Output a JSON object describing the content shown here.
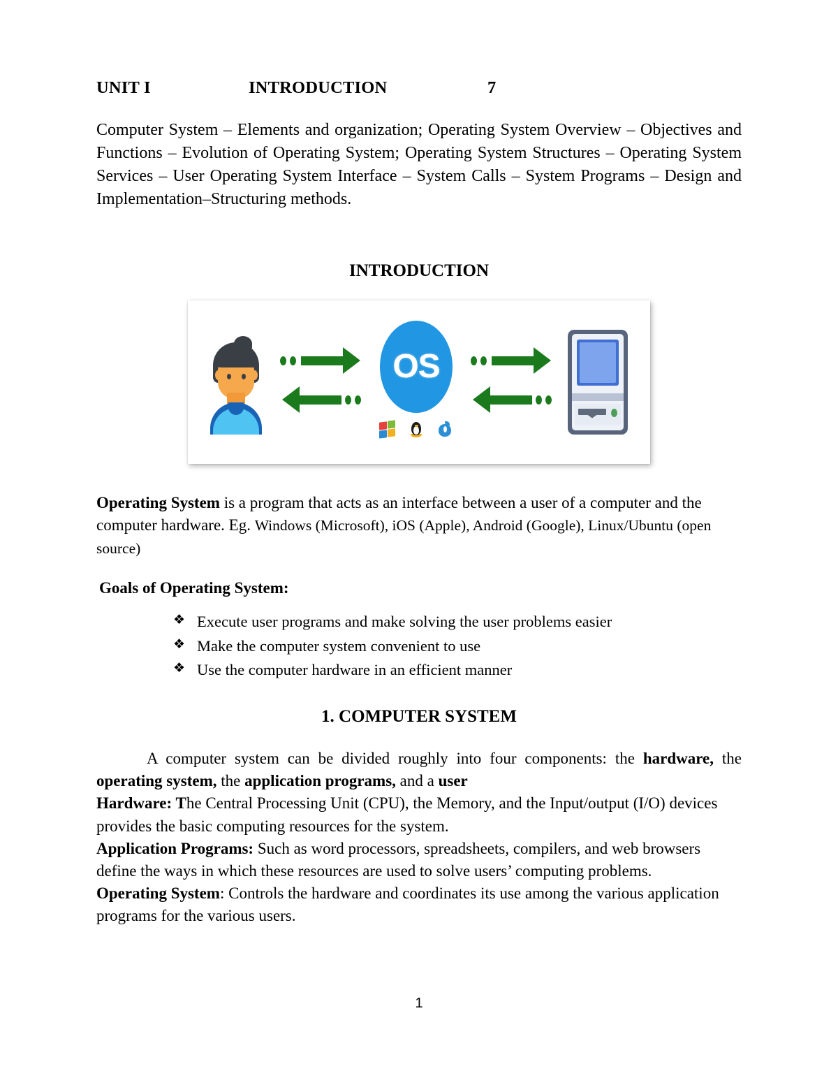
{
  "document": {
    "page_number": "1",
    "unit_header": {
      "unit_label": "UNIT  I",
      "unit_title": "INTRODUCTION",
      "hours": "7"
    },
    "syllabus": "Computer System – Elements and organization;  Operating System Overview – Objectives and Functions – Evolution of Operating System; Operating System Structures – Operating System Services – User Operating System Interface – System Calls – System Programs – Design and Implementation–Structuring methods.",
    "section_title": "INTRODUCTION",
    "figure": {
      "caption": "",
      "os_label": "OS",
      "actors": [
        "user-avatar",
        "os-ellipse",
        "desktop-computer"
      ],
      "os_logos": [
        "windows-logo",
        "linux-tux-logo",
        "apple-logo"
      ],
      "colors": {
        "os_blue": "#2196e3",
        "arrow_green": "#1a7a1c",
        "skin": "#f5a94c",
        "hair": "#3a3f46",
        "shirt": "#4fc3f2",
        "collar": "#1863b5",
        "pc_frame": "#58647c",
        "pc_screen": "#7ea4ee",
        "pc_led": "#4d9e5a"
      }
    },
    "definition": {
      "term": "Operating System",
      "text_1": " is a program that acts as an interface between a user of a computer and the computer hardware. Eg. ",
      "examples": "Windows (Microsoft), iOS (Apple), Android (Google), Linux/Ubuntu (open source)"
    },
    "goals": {
      "heading": "Goals of Operating System:",
      "bullet_glyph": "❖",
      "items": [
        "Execute user programs and make solving the user problems easier",
        "Make the computer system convenient to use",
        "Use the computer hardware in an efficient manner"
      ]
    },
    "computer_system": {
      "heading": "1.  COMPUTER SYSTEM",
      "intro_a": "A computer system can be divided roughly into four components: the ",
      "intro_b1": "hardware,",
      "intro_b2": " the ",
      "intro_b3": "operating system,",
      "intro_b4": " the ",
      "intro_b5": "application programs,",
      "intro_b6": " and a ",
      "intro_b7": "user",
      "items": [
        {
          "term": "Hardware:",
          "lead": " T",
          "text": "he Central Processing Unit (CPU), the Memory, and the  Input/output (I/O) devices provides the basic computing resources for the system."
        },
        {
          "term": "Application Programs:",
          "lead": "",
          "text": "  Such as word processors, spreadsheets, compilers, and web browsers define the ways in which these resources are used to solve users’ computing problems."
        },
        {
          "term": "Operating System",
          "lead": "",
          "text": ": Controls the hardware and coordinates its use among the various application programs for the various users."
        }
      ]
    }
  }
}
